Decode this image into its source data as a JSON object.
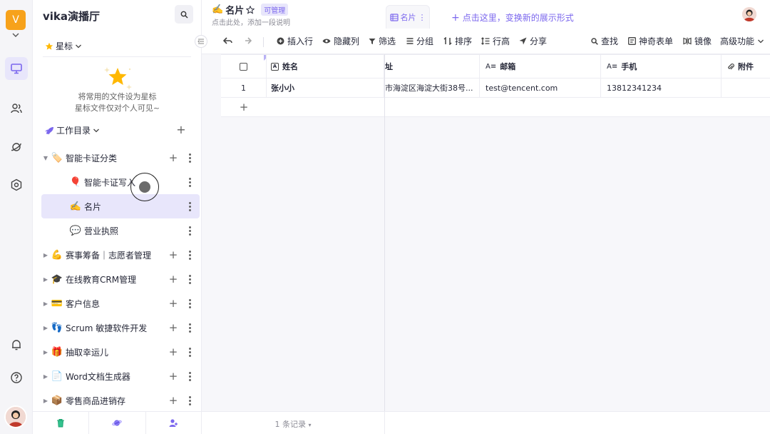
{
  "rail": {
    "space_initial": "V",
    "items": [
      {
        "name": "workbench-icon",
        "active": true
      },
      {
        "name": "members-icon",
        "active": false
      },
      {
        "name": "explore-icon",
        "active": false
      },
      {
        "name": "settings-icon",
        "active": false
      }
    ],
    "bottom": [
      "bell-icon",
      "help-icon"
    ]
  },
  "sidebar": {
    "title": "vika演播厅",
    "starred_label": "星标",
    "empty_line1": "将常用的文件设为星标",
    "empty_line2": "星标文件仅对个人可见~",
    "workdir_label": "工作目录",
    "tree": [
      {
        "emoji": "🏷️",
        "label": "智能卡证分类",
        "expanded": true,
        "has_children": true,
        "plus": true,
        "depth": 0
      },
      {
        "emoji": "🎈",
        "label": "智能卡证写入",
        "has_children": false,
        "plus": false,
        "depth": 1
      },
      {
        "emoji": "✍️",
        "label": "名片",
        "has_children": false,
        "plus": false,
        "depth": 1,
        "selected": true
      },
      {
        "emoji": "💬",
        "label": "营业执照",
        "has_children": false,
        "plus": false,
        "depth": 1
      },
      {
        "emoji": "💪",
        "label": "赛事筹备｜志愿者管理",
        "has_children": true,
        "plus": true,
        "depth": 0
      },
      {
        "emoji": "🎓",
        "label": "在线教育CRM管理",
        "has_children": true,
        "plus": true,
        "depth": 0
      },
      {
        "emoji": "💳",
        "label": "客户信息",
        "has_children": true,
        "plus": true,
        "depth": 0
      },
      {
        "emoji": "👣",
        "label": "Scrum 敏捷软件开发",
        "has_children": true,
        "plus": true,
        "depth": 0
      },
      {
        "emoji": "🎁",
        "label": "抽取幸运儿",
        "has_children": true,
        "plus": true,
        "depth": 0
      },
      {
        "emoji": "📄",
        "label": "Word文档生成器",
        "has_children": true,
        "plus": true,
        "depth": 0
      },
      {
        "emoji": "📦",
        "label": "零售商品进销存",
        "has_children": true,
        "plus": true,
        "depth": 0
      }
    ]
  },
  "header": {
    "title_emoji": "✍️",
    "title": "名片",
    "permission": "可管理",
    "description_placeholder": "点击此处，添加一段说明",
    "view_tab_label": "名片",
    "add_view_label": "点击这里，变换新的展示形式"
  },
  "toolbar": {
    "insert_row": "插入行",
    "hide_columns": "隐藏列",
    "filter": "筛选",
    "group": "分组",
    "sort": "排序",
    "row_height": "行高",
    "share": "分享",
    "find": "查找",
    "magic_form": "神奇表单",
    "mirror": "镜像",
    "advanced": "高级功能"
  },
  "table": {
    "columns": [
      {
        "icon": "A",
        "label": "姓名"
      },
      {
        "icon": "",
        "label": "址"
      },
      {
        "icon": "A≡",
        "label": "邮箱"
      },
      {
        "icon": "A≡",
        "label": "手机"
      },
      {
        "icon": "@",
        "label": "附件"
      }
    ],
    "rows": [
      {
        "index": "1",
        "name": "张小小",
        "address": "市海淀区海淀大街38号...",
        "email": "test@tencent.com",
        "phone": "13812341234",
        "attachment": ""
      }
    ],
    "add_row": "+",
    "record_count": "1 条记录"
  },
  "colors": {
    "accent": "#7b67ee",
    "space": "#f7a21b"
  }
}
